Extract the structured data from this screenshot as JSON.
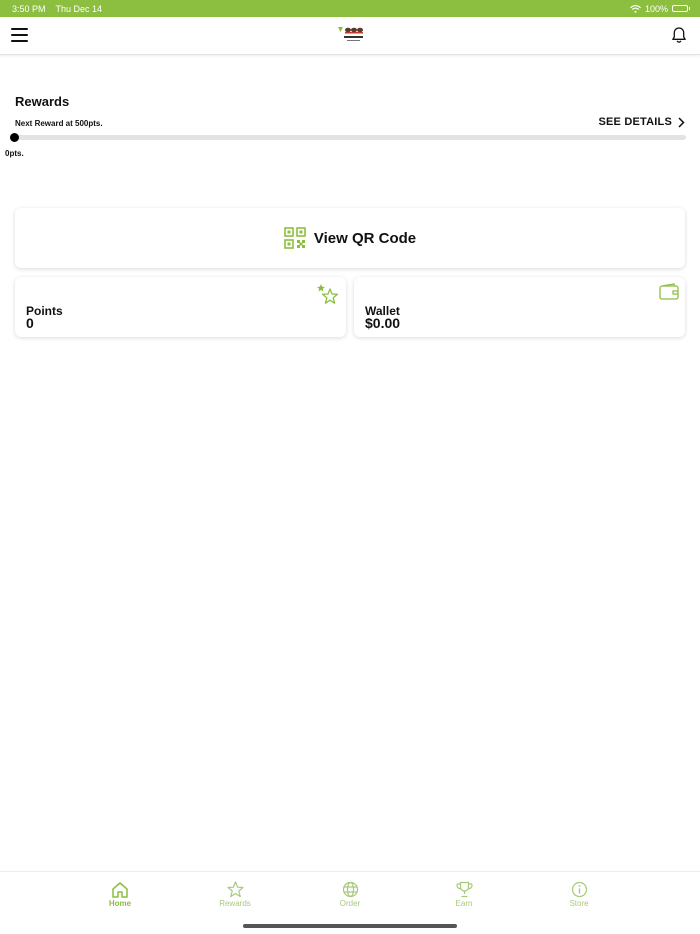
{
  "status_bar": {
    "time": "3:50 PM",
    "date": "Thu Dec 14",
    "battery": "100%",
    "wifi_icon": "wifi-icon",
    "battery_icon": "battery-icon"
  },
  "nav": {
    "menu_icon": "hamburger-menu-icon",
    "logo_icon": "brand-logo",
    "notification_icon": "bell-icon"
  },
  "rewards": {
    "title": "Rewards",
    "next_reward": "Next Reward at 500pts.",
    "see_details": "SEE DETAILS",
    "progress_label": "0pts.",
    "progress_fraction": 0
  },
  "qr": {
    "label": "View QR Code",
    "icon": "qr-code-icon"
  },
  "points": {
    "label": "Points",
    "value": "0",
    "icon": "stars-icon"
  },
  "wallet": {
    "label": "Wallet",
    "value": "$0.00",
    "icon": "wallet-icon"
  },
  "tabs": [
    {
      "label": "Home",
      "icon": "home-icon",
      "active": true
    },
    {
      "label": "Rewards",
      "icon": "star-icon",
      "active": false
    },
    {
      "label": "Order",
      "icon": "globe-icon",
      "active": false
    },
    {
      "label": "Earn",
      "icon": "trophy-icon",
      "active": false
    },
    {
      "label": "Store",
      "icon": "info-icon",
      "active": false
    }
  ],
  "colors": {
    "accent": "#8cbf3f",
    "accent_light": "#a7c97a",
    "text": "#111111"
  }
}
